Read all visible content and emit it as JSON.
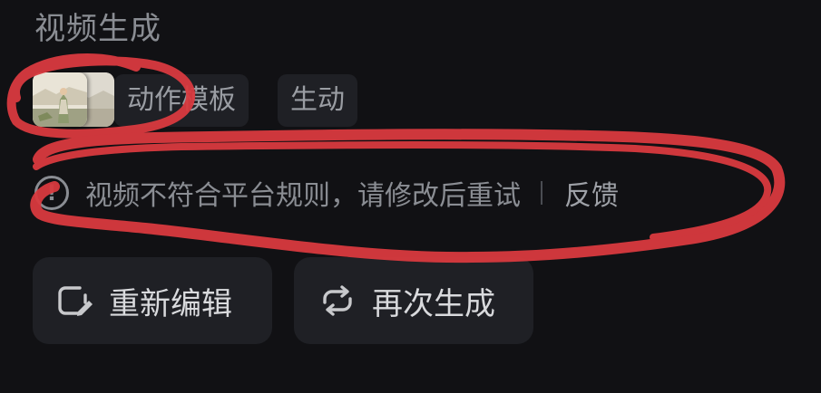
{
  "section": {
    "title": "视频生成"
  },
  "tags": [
    {
      "label": "动作模板"
    },
    {
      "label": "生动"
    }
  ],
  "error": {
    "icon": "exclamation-circle-icon",
    "message": "视频不符合平台规则，请修改后重试",
    "feedback_label": "反馈"
  },
  "actions": {
    "edit_label": "重新编辑",
    "edit_icon": "edit-square-pen-icon",
    "regenerate_label": "再次生成",
    "regenerate_icon": "refresh-loop-icon"
  },
  "colors": {
    "background": "#111114",
    "chip_bg": "#1f2025",
    "annotation_red": "#d93a3f"
  }
}
